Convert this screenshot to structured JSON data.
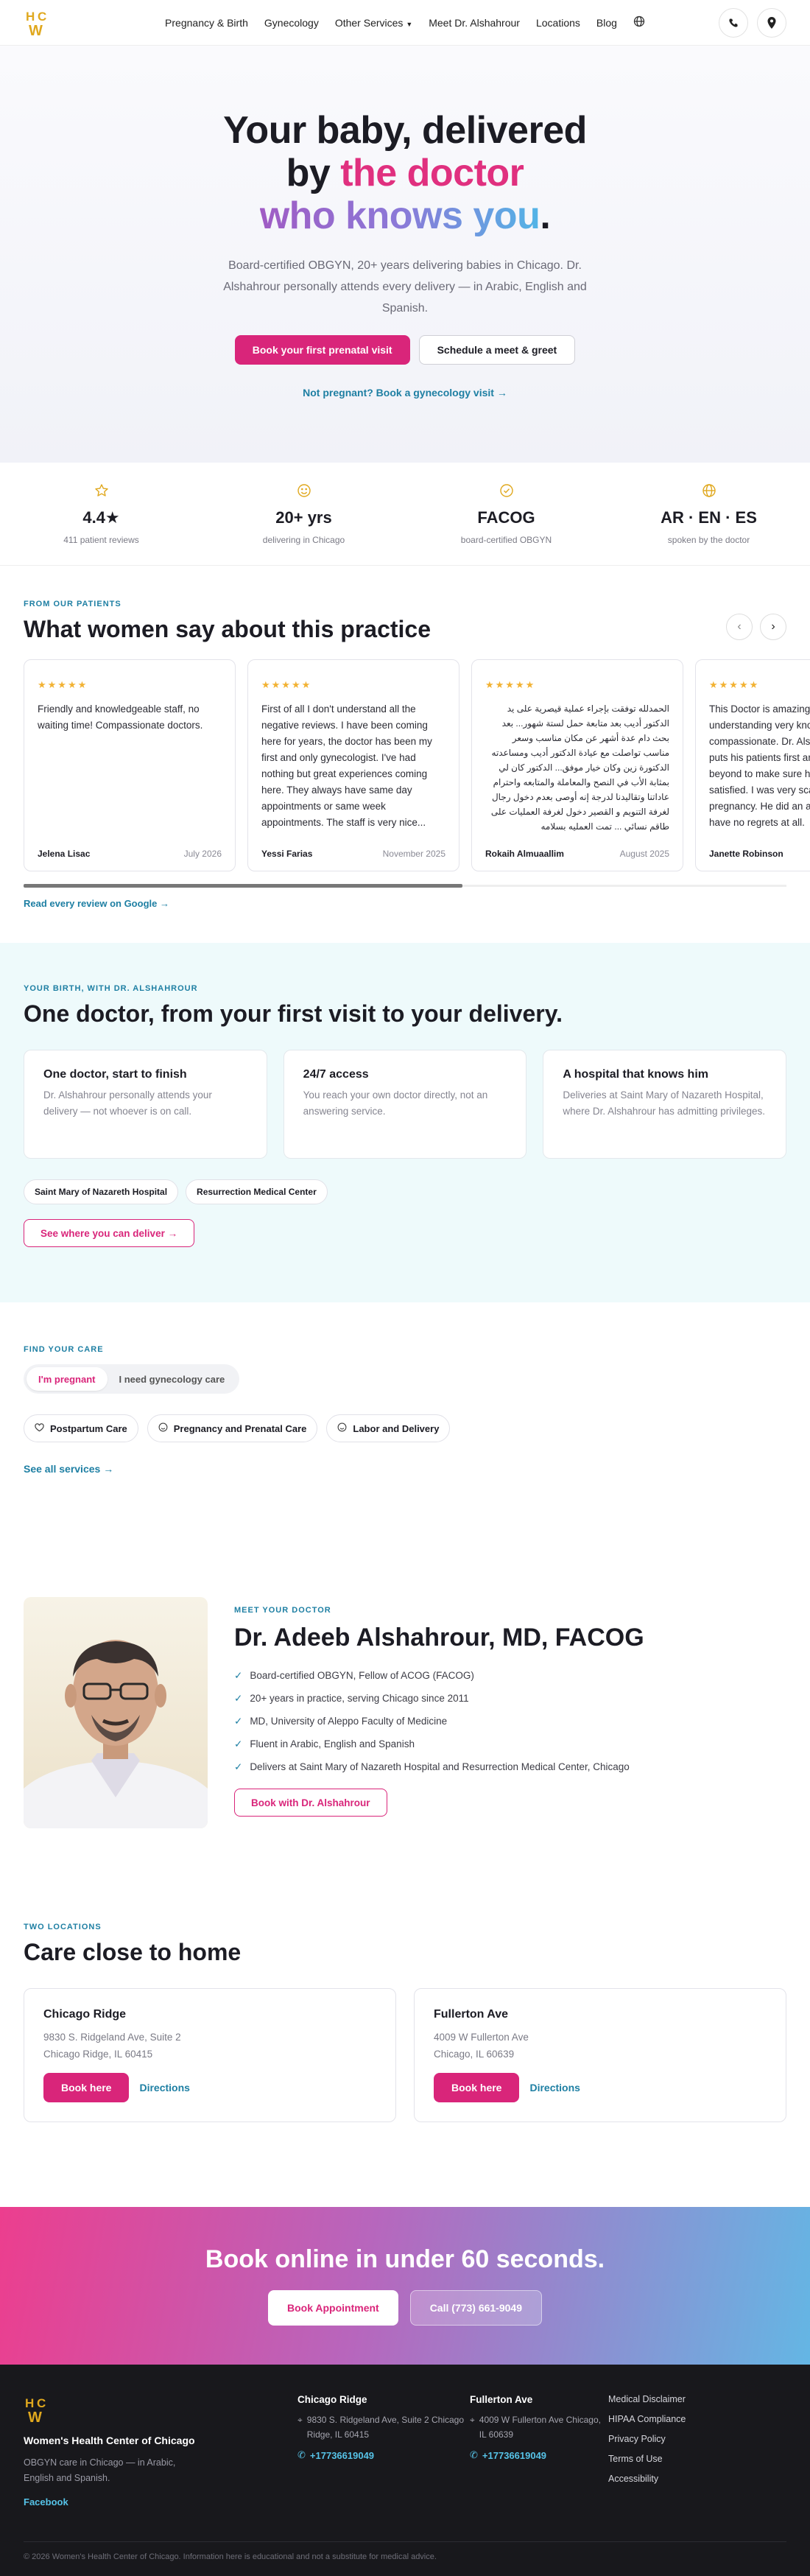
{
  "nav": {
    "links": [
      "Pregnancy & Birth",
      "Gynecology",
      "Other Services",
      "Meet Dr. Alshahrour",
      "Locations",
      "Blog"
    ]
  },
  "hero": {
    "line1": "Your baby, delivered",
    "line2_a": "by ",
    "line2_b": "the doctor",
    "line3": "who knows you",
    "period": ".",
    "subtitle": "Board-certified OBGYN, 20+ years delivering babies in Chicago. Dr. Alshahrour personally attends every delivery — in Arabic, English and Spanish.",
    "primary_btn": "Book your first prenatal visit",
    "secondary_btn": "Schedule a meet & greet",
    "gyn_link": "Not pregnant? Book a gynecology visit →"
  },
  "stats": [
    {
      "value": "4.4★",
      "label": "411 patient reviews",
      "icon": "star-icon"
    },
    {
      "value": "20+ yrs",
      "label": "delivering in Chicago",
      "icon": "smile-icon"
    },
    {
      "value": "FACOG",
      "label": "board-certified OBGYN",
      "icon": "badge-check-icon"
    },
    {
      "value": "AR · EN · ES",
      "label": "spoken by the doctor",
      "icon": "globe-icon"
    }
  ],
  "reviews": {
    "eyebrow": "FROM OUR PATIENTS",
    "title": "What women say about this practice",
    "google_link": "Read every review on Google →",
    "items": [
      {
        "stars": "★★★★★",
        "text": "Friendly and knowledgeable staff, no waiting time! Compassionate doctors.",
        "name": "Jelena Lisac",
        "date": "July 2026",
        "rtl": false
      },
      {
        "stars": "★★★★★",
        "text": "First of all I don't understand all the negative reviews. I have been coming here for years, the doctor has been my first and only gynecologist. I've had nothing but great experiences coming here. They always have same day appointments or same week appointments. The staff is very nice...",
        "name": "Yessi Farias",
        "date": "November 2025",
        "rtl": false
      },
      {
        "stars": "★★★★★",
        "text": "الحمدلله توفقت بإجراء عملية قيصرية على يد الدكتور أديب بعد متابعة حمل لستة شهور... بعد بحث دام عدة أشهر عن مكان مناسب وسعر مناسب تواصلت مع عيادة الدكتور أديب ومساعدته الدكتورة زين وكان خيار موفق... الدكتور كان لي بمثابة الأب في النصح والمعاملة والمتابعه واحترام عاداتنا وتقاليدنا لدرجة إنه أوصى بعدم دخول رجال لغرفة التنويم و القصير دخول لغرفة العمليات على طاقم نسائي ... تمت العمليه بسلامه",
        "name": "Rokaih Almuaallim",
        "date": "August 2025",
        "rtl": true
      },
      {
        "stars": "★★★★★",
        "text": "This Doctor is amazing, very understanding very knowledgeable, very compassionate. Dr. Alshahrour always puts his patients first and will go far beyond to make sure his patients are satisfied. I was very scared of my pregnancy. He did an amazing job and I have no regrets at all.",
        "name": "Janette Robinson",
        "date": "",
        "rtl": false
      }
    ]
  },
  "delivery": {
    "eyebrow": "YOUR BIRTH, WITH DR. ALSHAHROUR",
    "title": "One doctor, from your first visit to your delivery.",
    "features": [
      {
        "title": "One doctor, start to finish",
        "text": "Dr. Alshahrour personally attends your delivery — not whoever is on call."
      },
      {
        "title": "24/7 access",
        "text": "You reach your own doctor directly, not an answering service."
      },
      {
        "title": "A hospital that knows him",
        "text": "Deliveries at Saint Mary of Nazareth Hospital, where Dr. Alshahrour has admitting privileges."
      }
    ],
    "hospitals": [
      "Saint Mary of Nazareth Hospital",
      "Resurrection Medical Center"
    ],
    "cta": "See where you can deliver →"
  },
  "findcare": {
    "eyebrow": "FIND YOUR CARE",
    "tabs": [
      "I'm pregnant",
      "I need gynecology care"
    ],
    "services": [
      {
        "label": "Postpartum Care",
        "icon": "heart-icon"
      },
      {
        "label": "Pregnancy and Prenatal Care",
        "icon": "smile-icon"
      },
      {
        "label": "Labor and Delivery",
        "icon": "smile-icon"
      }
    ],
    "all_link": "See all services →"
  },
  "doctor": {
    "eyebrow": "MEET YOUR DOCTOR",
    "name": "Dr. Adeeb Alshahrour, MD, FACOG",
    "points": [
      "Board-certified OBGYN, Fellow of ACOG (FACOG)",
      "20+ years in practice, serving Chicago since 2011",
      "MD, University of Aleppo Faculty of Medicine",
      "Fluent in Arabic, English and Spanish",
      "Delivers at Saint Mary of Nazareth Hospital and Resurrection Medical Center, Chicago"
    ],
    "cta": "Book with Dr. Alshahrour"
  },
  "locations": {
    "eyebrow": "TWO LOCATIONS",
    "title": "Care close to home",
    "items": [
      {
        "name": "Chicago Ridge",
        "addr1": "9830 S. Ridgeland Ave, Suite 2",
        "addr2": "Chicago Ridge, IL 60415",
        "book": "Book here",
        "dir": "Directions"
      },
      {
        "name": "Fullerton Ave",
        "addr1": "4009 W Fullerton Ave",
        "addr2": "Chicago, IL 60639",
        "book": "Book here",
        "dir": "Directions"
      }
    ]
  },
  "cta": {
    "title": "Book online in under 60 seconds.",
    "book": "Book Appointment",
    "call": "Call (773) 661-9049"
  },
  "footer": {
    "brand": "Women's Health Center of Chicago",
    "tagline": "OBGYN care in Chicago — in Arabic, English and Spanish.",
    "facebook": "Facebook",
    "col1": {
      "title": "Chicago Ridge",
      "addr": "9830 S. Ridgeland Ave, Suite 2 Chicago Ridge, IL 60415",
      "phone": "+17736619049"
    },
    "col2": {
      "title": "Fullerton Ave",
      "addr": "4009 W Fullerton Ave Chicago, IL 60639",
      "phone": "+17736619049"
    },
    "links": [
      "Medical Disclaimer",
      "HIPAA Compliance",
      "Privacy Policy",
      "Terms of Use",
      "Accessibility"
    ],
    "copyright": "© 2026 Women's Health Center of Chicago. Information here is educational and not a substitute for medical advice."
  },
  "colors": {
    "accent": "#d9257a",
    "teal": "#1e7fa3",
    "star": "#f2b233"
  }
}
